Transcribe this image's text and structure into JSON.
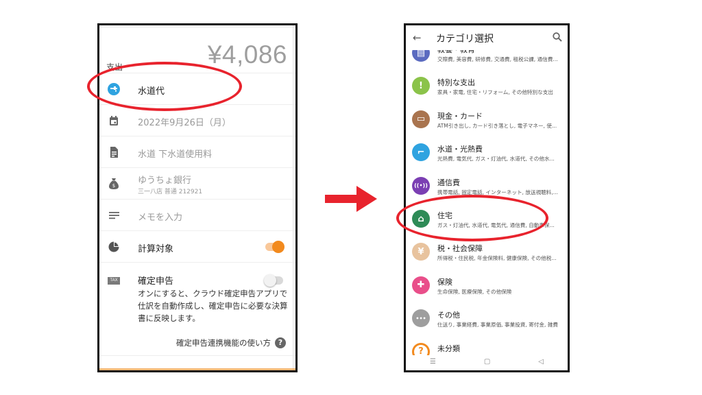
{
  "left_phone": {
    "amount_label": "支出",
    "amount_value": "¥4,086",
    "category": "水道代",
    "date": "2022年9月26日（月）",
    "memo_title": "水道 下水道使用料",
    "account_name": "ゆうちょ銀行",
    "account_detail": "三一八店 普通 212921",
    "memo_placeholder": "メモを入力",
    "calc_target_label": "計算対象",
    "tax_badge": "TAX",
    "tax_label": "確定申告",
    "tax_description": "オンにすると、クラウド確定申告アプリで仕訳を自動作成し、確定申告に必要な決算書に反映します。",
    "help_link": "確定申告連携機能の使い方",
    "help_icon_glyph": "?"
  },
  "right_phone": {
    "title": "カテゴリ選択",
    "back_glyph": "←",
    "categories": [
      {
        "name": "教養・教育",
        "desc": "交際費, 美容費, 研修費, 交通費, 租税公課, 通信費...",
        "color": "#5b6bc0",
        "icon": "book-icon"
      },
      {
        "name": "特別な支出",
        "desc": "家具・家電, 住宅・リフォーム, その他特別な支出",
        "color": "#8bc34a",
        "icon": "exclamation-icon"
      },
      {
        "name": "現金・カード",
        "desc": "ATM引き出し, カード引き落とし, 電子マネー, 使...",
        "color": "#a9744f",
        "icon": "card-icon"
      },
      {
        "name": "水道・光熱費",
        "desc": "光熱費, 電気代, ガス・灯油代, 水道代, その他水...",
        "color": "#2fa3e0",
        "icon": "faucet-icon"
      },
      {
        "name": "通信費",
        "desc": "携帯電話, 固定電話, インターネット, 放送視聴料,...",
        "color": "#7b3fb3",
        "icon": "antenna-icon"
      },
      {
        "name": "住宅",
        "desc": "ガス・灯油代, 水道代, 電気代, 通信費, 自動車保...",
        "color": "#2e8b57",
        "icon": "house-icon"
      },
      {
        "name": "税・社会保障",
        "desc": "所得税・住民税, 年金保険料, 健康保険, その他税...",
        "color": "#e8c39e",
        "icon": "tax-icon"
      },
      {
        "name": "保険",
        "desc": "生命保険, 医療保険, その他保険",
        "color": "#e94f8a",
        "icon": "medical-icon"
      },
      {
        "name": "その他",
        "desc": "仕送り, 事業経費, 事業原価, 事業投資, 寄付金, 雑費",
        "color": "#9e9e9e",
        "icon": "more-icon"
      },
      {
        "name": "未分類",
        "desc": "",
        "color": "#f28a1e",
        "icon": "unknown-icon"
      }
    ],
    "nav": {
      "menu": "☰",
      "home": "▢",
      "back": "◁"
    }
  },
  "colors": {
    "accent": "#f28a1e",
    "highlight": "#e8232d",
    "water_blue": "#2fa3e0"
  }
}
